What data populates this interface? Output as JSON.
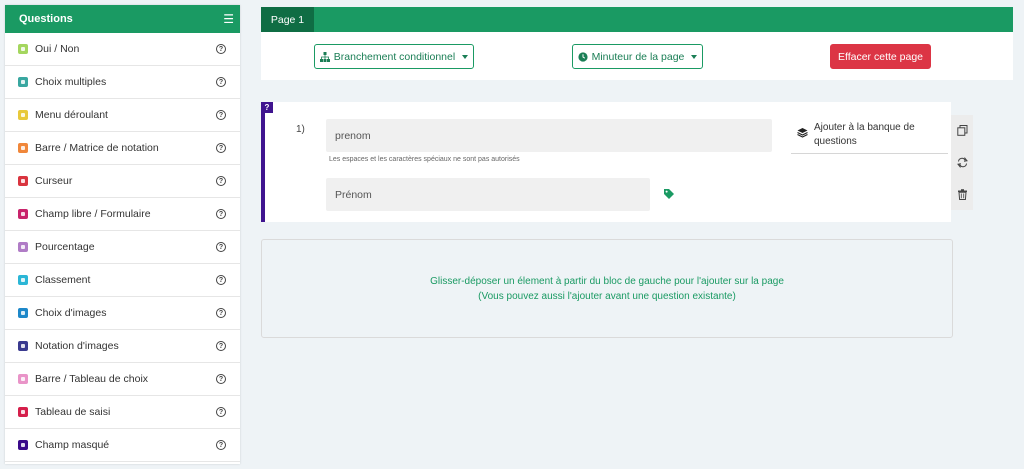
{
  "sidebar": {
    "title": "Questions",
    "items": [
      {
        "label": "Oui / Non",
        "icon": "check-icon",
        "color": "#a4d65e"
      },
      {
        "label": "Choix multiples",
        "icon": "radio-icon",
        "color": "#39a7a0"
      },
      {
        "label": "Menu déroulant",
        "icon": "dropdown-icon",
        "color": "#e8c93b"
      },
      {
        "label": "Barre / Matrice de notation",
        "icon": "rating-icon",
        "color": "#f0873a"
      },
      {
        "label": "Curseur",
        "icon": "slider-icon",
        "color": "#d9343f"
      },
      {
        "label": "Champ libre / Formulaire",
        "icon": "textfield-icon",
        "color": "#c8246b"
      },
      {
        "label": "Pourcentage",
        "icon": "percent-icon",
        "color": "#b07cc6"
      },
      {
        "label": "Classement",
        "icon": "ranking-icon",
        "color": "#2bb6d6"
      },
      {
        "label": "Choix d'images",
        "icon": "image-choice-icon",
        "color": "#1e88c9"
      },
      {
        "label": "Notation d'images",
        "icon": "image-rating-icon",
        "color": "#3a3a8f"
      },
      {
        "label": "Barre / Tableau de choix",
        "icon": "choice-table-icon",
        "color": "#e994c8"
      },
      {
        "label": "Tableau de saisi",
        "icon": "input-table-icon",
        "color": "#d51f4b"
      },
      {
        "label": "Champ masqué",
        "icon": "hidden-field-icon",
        "color": "#3a0a8a"
      }
    ]
  },
  "tabs": [
    {
      "label": "Page 1"
    }
  ],
  "toolbar": {
    "branching_label": "Branchement conditionnel",
    "timer_label": "Minuteur de la page",
    "delete_label": "Effacer cette page"
  },
  "question": {
    "badge": "?",
    "number": "1)",
    "field_name": "prenom",
    "field_hint": "Les espaces et les caractères spéciaux ne sont pas autorisés",
    "field_label": "Prénom",
    "bank_label": "Ajouter à la banque de questions"
  },
  "dropzone": {
    "line1": "Glisser-déposer un élement à partir du bloc de gauche pour l'ajouter sur la page",
    "line2": "(Vous pouvez aussi l'ajouter avant une question existante)"
  },
  "colors": {
    "brand_green": "#1a9a63",
    "tab_active": "#0f6d44",
    "danger": "#dc3545",
    "question_accent": "#3f148f"
  }
}
